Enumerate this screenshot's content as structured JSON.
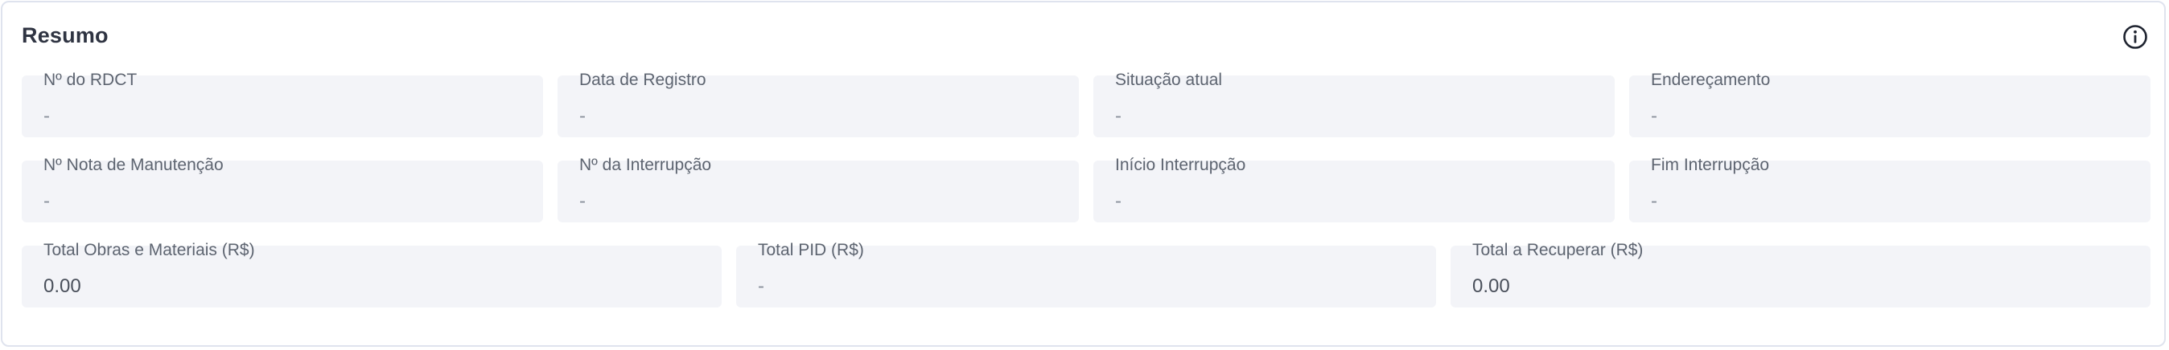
{
  "card": {
    "title": "Resumo",
    "info_icon": "info-circle-icon"
  },
  "rows": [
    [
      {
        "label": "Nº do RDCT",
        "value": "-"
      },
      {
        "label": "Data de Registro",
        "value": "-"
      },
      {
        "label": "Situação atual",
        "value": "-"
      },
      {
        "label": "Endereçamento",
        "value": "-"
      }
    ],
    [
      {
        "label": "Nº Nota de Manutenção",
        "value": "-"
      },
      {
        "label": "Nº da Interrupção",
        "value": "-"
      },
      {
        "label": "Início Interrupção",
        "value": "-"
      },
      {
        "label": "Fim Interrupção",
        "value": "-"
      }
    ],
    [
      {
        "label": "Total Obras e Materiais (R$)",
        "value": "0.00"
      },
      {
        "label": "Total PID (R$)",
        "value": "-"
      },
      {
        "label": "Total a Recuperar (R$)",
        "value": "0.00"
      }
    ]
  ]
}
